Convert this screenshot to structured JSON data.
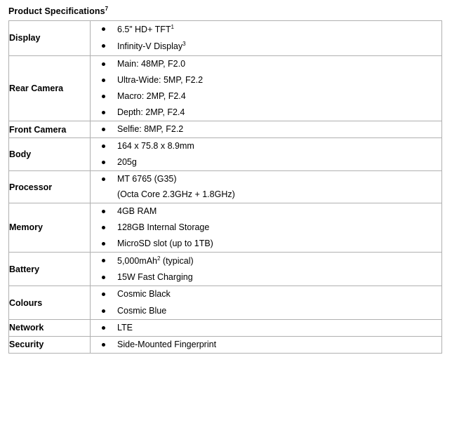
{
  "document": {
    "title": "Product Specifications",
    "title_footnote": "7"
  },
  "spec_table": {
    "rows": [
      {
        "label": "Display",
        "items": [
          {
            "text": "6.5” HD+ TFT",
            "sup": "1",
            "continuation": false
          },
          {
            "text": "Infinity-V Display",
            "sup": "3",
            "continuation": false
          }
        ]
      },
      {
        "label": "Rear Camera",
        "items": [
          {
            "text": "Main: 48MP, F2.0",
            "sup": "",
            "continuation": false
          },
          {
            "text": "Ultra-Wide: 5MP, F2.2",
            "sup": "",
            "continuation": false
          },
          {
            "text": "Macro: 2MP, F2.4",
            "sup": "",
            "continuation": false
          },
          {
            "text": "Depth: 2MP, F2.4",
            "sup": "",
            "continuation": false
          }
        ]
      },
      {
        "label": "Front Camera",
        "items": [
          {
            "text": "Selfie: 8MP, F2.2",
            "sup": "",
            "continuation": false
          }
        ]
      },
      {
        "label": "Body",
        "items": [
          {
            "text": "164 x 75.8 x 8.9mm",
            "sup": "",
            "continuation": false
          },
          {
            "text": "205g",
            "sup": "",
            "continuation": false
          }
        ]
      },
      {
        "label": "Processor",
        "items": [
          {
            "text": "MT 6765 (G35)",
            "sup": "",
            "continuation": false
          },
          {
            "text": "(Octa Core 2.3GHz + 1.8GHz)",
            "sup": "",
            "continuation": true
          }
        ]
      },
      {
        "label": "Memory",
        "items": [
          {
            "text": "4GB RAM",
            "sup": "",
            "continuation": false
          },
          {
            "text": "128GB Internal Storage",
            "sup": "",
            "continuation": false
          },
          {
            "text": "MicroSD slot (up to 1TB)",
            "sup": "",
            "continuation": false
          }
        ]
      },
      {
        "label": "Battery",
        "items": [
          {
            "text": "5,000mAh",
            "sup": "2",
            "text_after_sup": " (typical)",
            "continuation": false
          },
          {
            "text": "15W Fast Charging",
            "sup": "",
            "continuation": false
          }
        ]
      },
      {
        "label": "Colours",
        "items": [
          {
            "text": "Cosmic Black",
            "sup": "",
            "continuation": false
          },
          {
            "text": "Cosmic Blue",
            "sup": "",
            "continuation": false
          }
        ]
      },
      {
        "label": "Network",
        "items": [
          {
            "text": "LTE",
            "sup": "",
            "continuation": false
          }
        ]
      },
      {
        "label": "Security",
        "items": [
          {
            "text": "Side-Mounted Fingerprint",
            "sup": "",
            "continuation": false
          }
        ]
      }
    ]
  },
  "colors": {
    "text": "#000000",
    "border": "#b0b0b0",
    "background": "#ffffff"
  }
}
